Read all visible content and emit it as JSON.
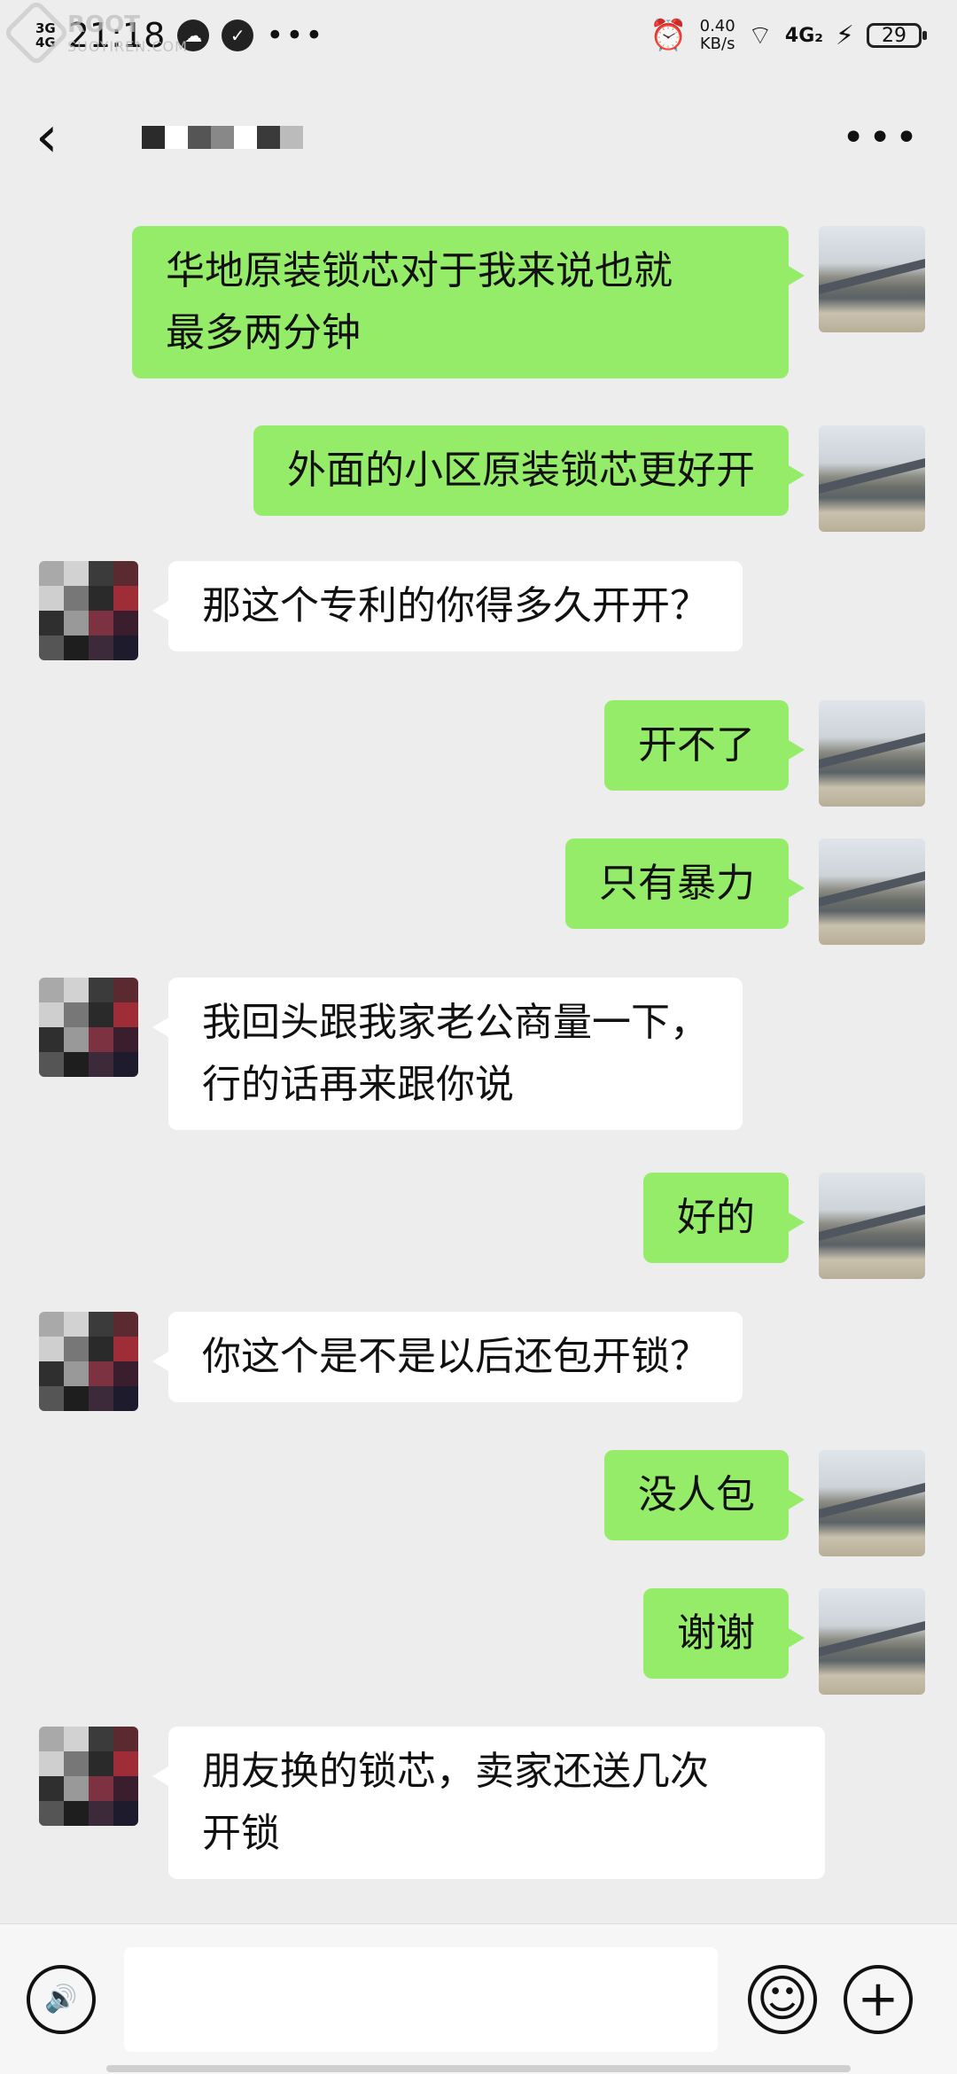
{
  "status_bar": {
    "net_top": "3G",
    "net_top2": "4G",
    "time": "21:18",
    "dots": "•••",
    "speed_value": "0.40",
    "speed_unit": "KB/s",
    "network": "4G₂",
    "battery": "29"
  },
  "watermark": {
    "main": "ROOT",
    "sub": "SUOYIREN.COM"
  },
  "nav": {
    "back_icon": "chevron-left-icon",
    "more_icon": "more-icon",
    "more_label": "•••"
  },
  "messages": [
    {
      "side": "right",
      "lines": [
        "华地原装锁芯对于我来说也就",
        "最多两分钟"
      ]
    },
    {
      "side": "right",
      "lines": [
        "外面的小区原装锁芯更好开"
      ]
    },
    {
      "side": "left",
      "lines": [
        "那这个专利的你得多久开开？"
      ]
    },
    {
      "side": "right",
      "lines": [
        "开不了"
      ]
    },
    {
      "side": "right",
      "lines": [
        "只有暴力"
      ]
    },
    {
      "side": "left",
      "lines": [
        "我回头跟我家老公商量一下，",
        "行的话再来跟你说"
      ]
    },
    {
      "side": "right",
      "lines": [
        "好的"
      ]
    },
    {
      "side": "left",
      "lines": [
        "你这个是不是以后还包开锁？"
      ]
    },
    {
      "side": "right",
      "lines": [
        "没人包"
      ]
    },
    {
      "side": "right",
      "lines": [
        "谢谢"
      ]
    },
    {
      "side": "left",
      "lines": [
        "朋友换的锁芯，卖家还送几次",
        "开锁"
      ]
    }
  ],
  "input_bar": {
    "voice_icon": "voice-icon",
    "emoji_icon": "emoji-icon",
    "plus_icon": "plus-icon",
    "voice_glyph": "🔊",
    "emoji_glyph": "☺",
    "plus_glyph": "+",
    "input_value": ""
  },
  "colors": {
    "background": "#ededed",
    "sent_bubble": "#95ec69",
    "received_bubble": "#ffffff"
  }
}
